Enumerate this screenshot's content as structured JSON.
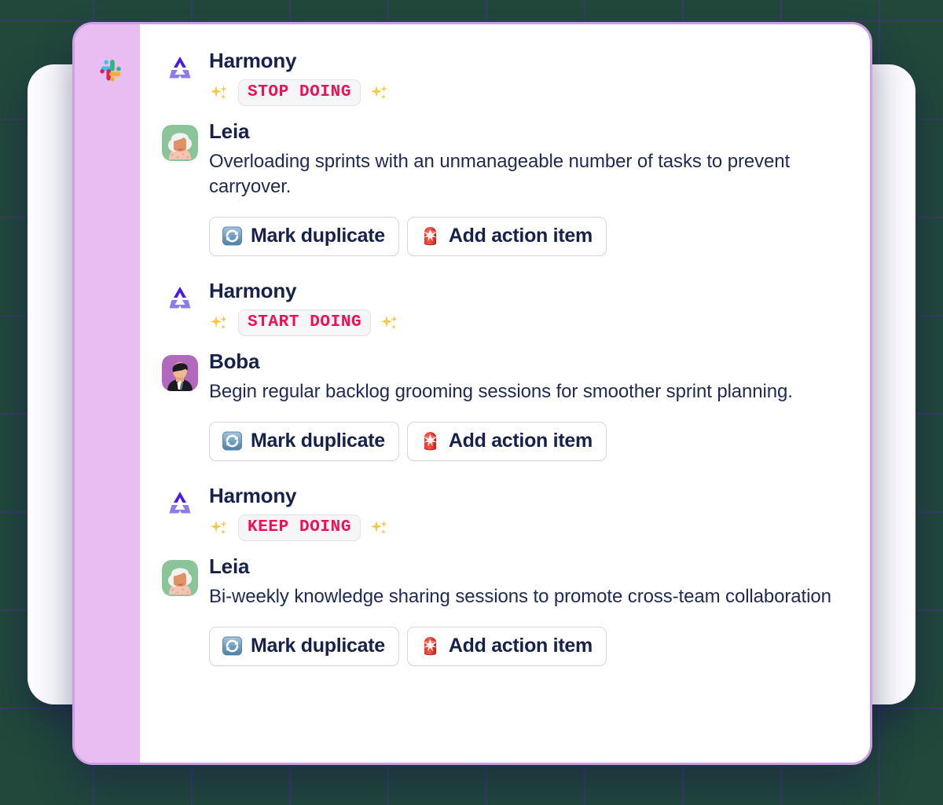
{
  "app": {
    "logo": "slack-logo",
    "brand_colors": {
      "slack_cyan": "#36c5f0",
      "slack_green": "#2eb67d",
      "slack_red": "#e01e5a",
      "slack_yellow": "#ecb22e"
    },
    "sidebar_color": "#e9bdf2",
    "card_border_color": "#cf9ee8",
    "background_color": "#21483b",
    "badge_text_color": "#ef1054",
    "text_color": "#17224a"
  },
  "messages": [
    {
      "author": "Harmony",
      "avatar": "harmony-bot-logo",
      "type": "badge",
      "badge": "STOP DOING",
      "sparkle_left": "sparkles-emoji",
      "sparkle_right": "sparkles-emoji"
    },
    {
      "author": "Leia",
      "avatar": "leia-avatar",
      "type": "text",
      "text": "Overloading sprints with an unmanageable number of tasks to prevent carryover.",
      "actions": [
        {
          "label": "Mark duplicate",
          "icon": "arrows-counterclockwise-emoji"
        },
        {
          "label": "Add action item",
          "icon": "rotating-light-emoji"
        }
      ]
    },
    {
      "author": "Harmony",
      "avatar": "harmony-bot-logo",
      "type": "badge",
      "badge": "START DOING",
      "sparkle_left": "sparkles-emoji",
      "sparkle_right": "sparkles-emoji"
    },
    {
      "author": "Boba",
      "avatar": "boba-avatar",
      "type": "text",
      "text": "Begin regular backlog grooming sessions for smoother sprint planning.",
      "actions": [
        {
          "label": "Mark duplicate",
          "icon": "arrows-counterclockwise-emoji"
        },
        {
          "label": "Add action item",
          "icon": "rotating-light-emoji"
        }
      ]
    },
    {
      "author": "Harmony",
      "avatar": "harmony-bot-logo",
      "type": "badge",
      "badge": "KEEP DOING",
      "sparkle_left": "sparkles-emoji",
      "sparkle_right": "sparkles-emoji"
    },
    {
      "author": "Leia",
      "avatar": "leia-avatar",
      "type": "text",
      "text": "Bi-weekly knowledge sharing sessions to promote cross-team collaboration",
      "actions": [
        {
          "label": "Mark duplicate",
          "icon": "arrows-counterclockwise-emoji"
        },
        {
          "label": "Add action item",
          "icon": "rotating-light-emoji"
        }
      ]
    }
  ]
}
